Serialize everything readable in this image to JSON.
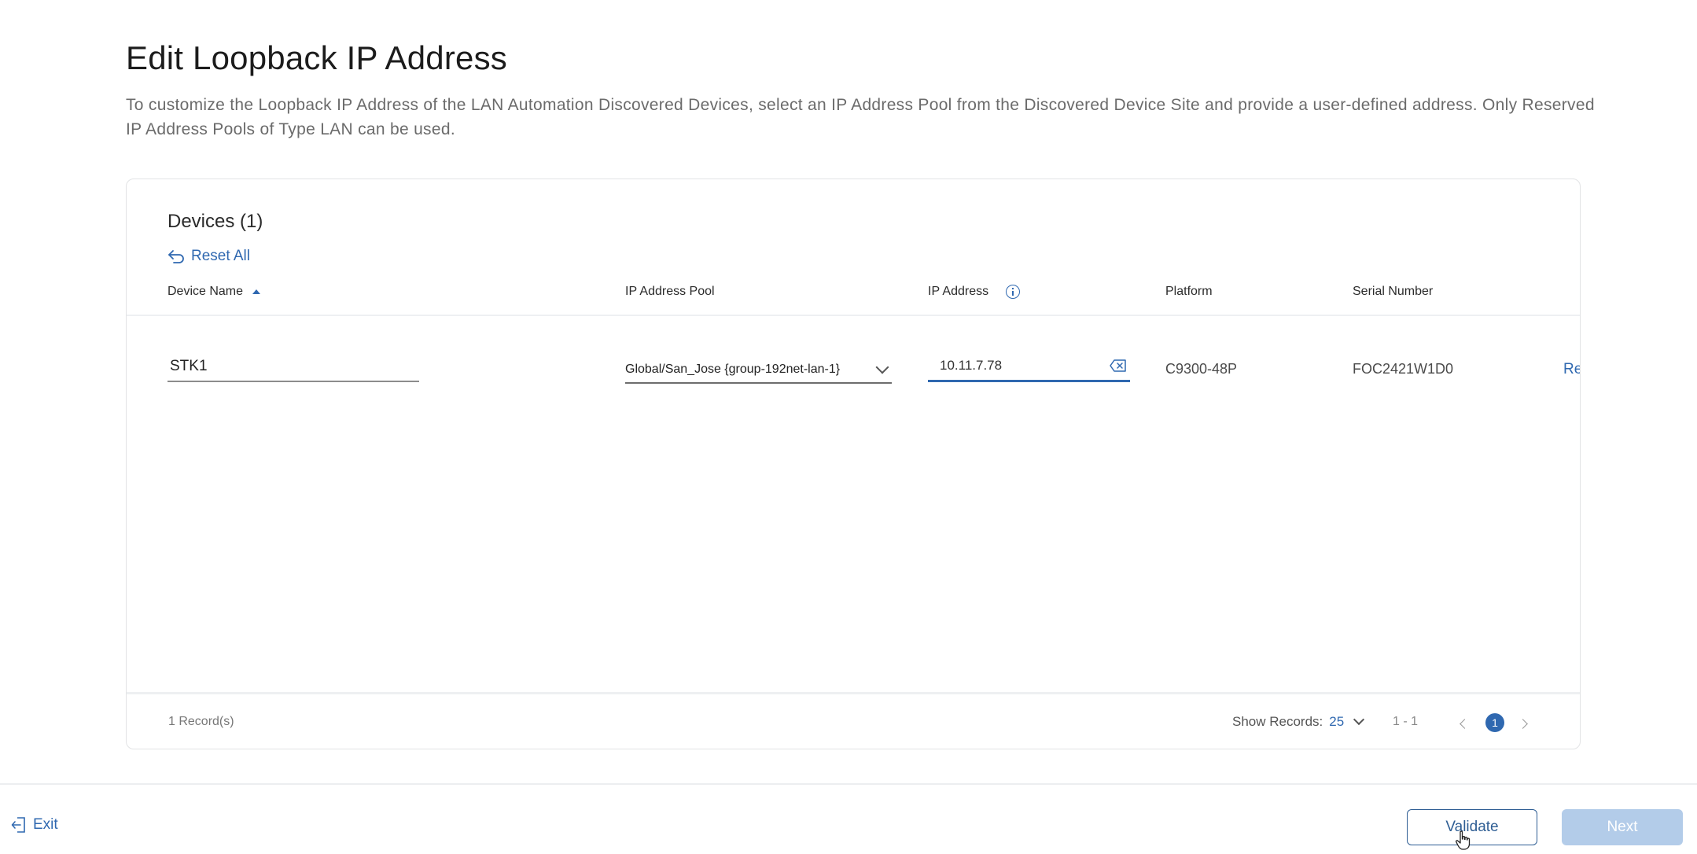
{
  "page": {
    "title": "Edit Loopback IP Address",
    "description": "To customize the Loopback IP Address of the LAN Automation Discovered Devices, select an IP Address Pool from the Discovered Device Site and provide a user-defined address. Only Reserved IP Address Pools of Type LAN can be used."
  },
  "devices_card": {
    "title": "Devices (1)",
    "reset_all_label": "Reset All",
    "columns": {
      "device_name": "Device Name",
      "ip_pool": "IP Address Pool",
      "ip_address": "IP Address",
      "platform": "Platform",
      "serial_number": "Serial Number"
    },
    "rows": [
      {
        "device_name": "STK1",
        "ip_pool": "Global/San_Jose {group-192net-lan-1}",
        "ip_address": "10.11.7.78",
        "platform": "C9300-48P",
        "serial_number": "FOC2421W1D0",
        "action": "Re"
      }
    ],
    "footer": {
      "records": "1 Record(s)",
      "show_records_label": "Show Records:",
      "show_records_value": "25",
      "range": "1 - 1",
      "current_page": "1"
    }
  },
  "actions": {
    "exit_label": "Exit",
    "validate_label": "Validate",
    "next_label": "Next"
  },
  "colors": {
    "accent": "#2f68b0",
    "next_disabled": "#b3cce9"
  },
  "icons": [
    "reset-icon",
    "sort-ascending-icon",
    "info-icon",
    "chevron-down-icon",
    "clear-input-icon",
    "chevron-left-icon",
    "chevron-right-icon",
    "exit-icon",
    "mouse-pointer-icon"
  ]
}
